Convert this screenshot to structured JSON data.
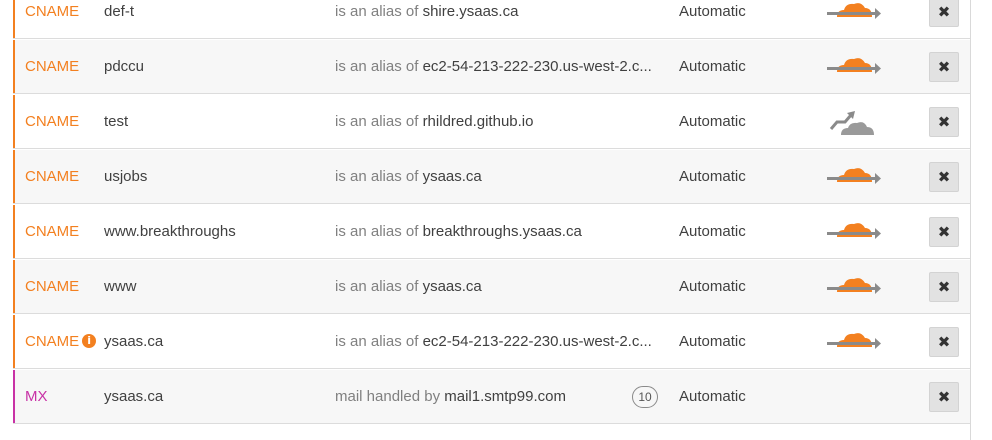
{
  "colors": {
    "cname": "#f38020",
    "mx": "#c832a6",
    "proxied_cloud": "#f38020",
    "dns_only_cloud": "#9a9a9a",
    "arrow": "#8a8a8a"
  },
  "records": [
    {
      "type": "CNAME",
      "name": "def-t",
      "value_prefix": "is an alias of",
      "value": "shire.ysaas.ca",
      "ttl": "Automatic",
      "proxy": "proxied",
      "info": false
    },
    {
      "type": "CNAME",
      "name": "pdccu",
      "value_prefix": "is an alias of",
      "value": "ec2-54-213-222-230.us-west-2.c...",
      "ttl": "Automatic",
      "proxy": "proxied",
      "info": false
    },
    {
      "type": "CNAME",
      "name": "test",
      "value_prefix": "is an alias of",
      "value": "rhildred.github.io",
      "ttl": "Automatic",
      "proxy": "dns-only",
      "info": false
    },
    {
      "type": "CNAME",
      "name": "usjobs",
      "value_prefix": "is an alias of",
      "value": "ysaas.ca",
      "ttl": "Automatic",
      "proxy": "proxied",
      "info": false
    },
    {
      "type": "CNAME",
      "name": "www.breakthroughs",
      "value_prefix": "is an alias of",
      "value": "breakthroughs.ysaas.ca",
      "ttl": "Automatic",
      "proxy": "proxied",
      "info": false
    },
    {
      "type": "CNAME",
      "name": "www",
      "value_prefix": "is an alias of",
      "value": "ysaas.ca",
      "ttl": "Automatic",
      "proxy": "proxied",
      "info": false
    },
    {
      "type": "CNAME",
      "name": "ysaas.ca",
      "value_prefix": "is an alias of",
      "value": "ec2-54-213-222-230.us-west-2.c...",
      "ttl": "Automatic",
      "proxy": "proxied",
      "info": true
    },
    {
      "type": "MX",
      "name": "ysaas.ca",
      "value_prefix": "mail handled by",
      "value": "mail1.smtp99.com",
      "priority": "10",
      "ttl": "Automatic",
      "proxy": "none",
      "info": false
    }
  ],
  "icons": {
    "delete": "close-icon",
    "info": "info-icon",
    "proxied": "proxied-cloud-icon",
    "dns_only": "dns-only-cloud-icon"
  },
  "delete_glyph": "✖",
  "info_glyph": "i"
}
